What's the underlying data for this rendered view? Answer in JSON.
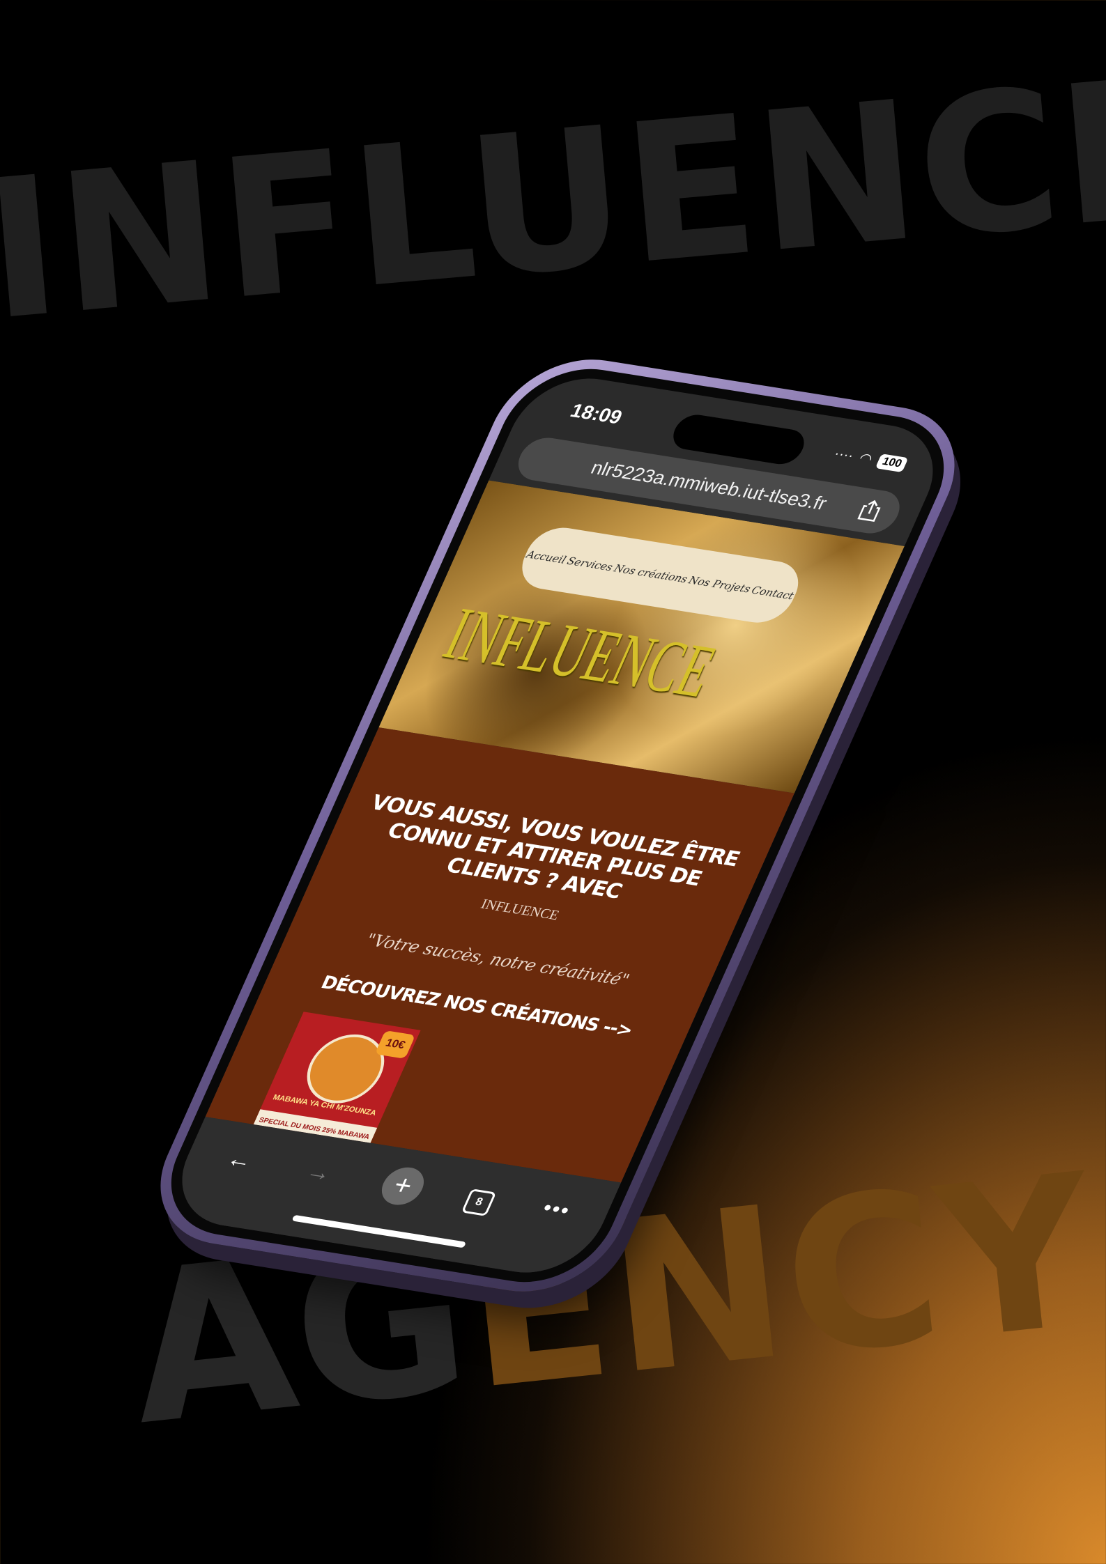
{
  "background": {
    "word_top": "INFLUENCE",
    "word_bottom_part1": "AG",
    "word_bottom_part2": "ENCY",
    "accent_color": "#d8892b"
  },
  "status_bar": {
    "time": "18:09",
    "battery": "100"
  },
  "browser": {
    "url": "nlr5223a.mmiweb.iut-tlse3.fr"
  },
  "site": {
    "nav": [
      "Accueil",
      "Services",
      "Nos créations",
      "Nos Projets",
      "Contact"
    ],
    "hero_title": "INFLUENCE",
    "headline": "VOUS AUSSI, VOUS VOULEZ ÊTRE CONNU ET ATTIRER PLUS DE CLIENTS ? AVEC",
    "brand_small": "INFLUENCE",
    "slogan": "\"Votre succès, notre créativité\"",
    "cta": "DÉCOUVREZ NOS CRÉATIONS -->",
    "promo": {
      "price": "10€",
      "title": "MABAWA YA CHI M'ZOUNZA",
      "special": "SPECIAL DU MOIS 25% MABAWA"
    }
  },
  "toolbar": {
    "back": "←",
    "forward": "→",
    "new_tab": "+",
    "tabs_count": "8",
    "more": "•••"
  }
}
